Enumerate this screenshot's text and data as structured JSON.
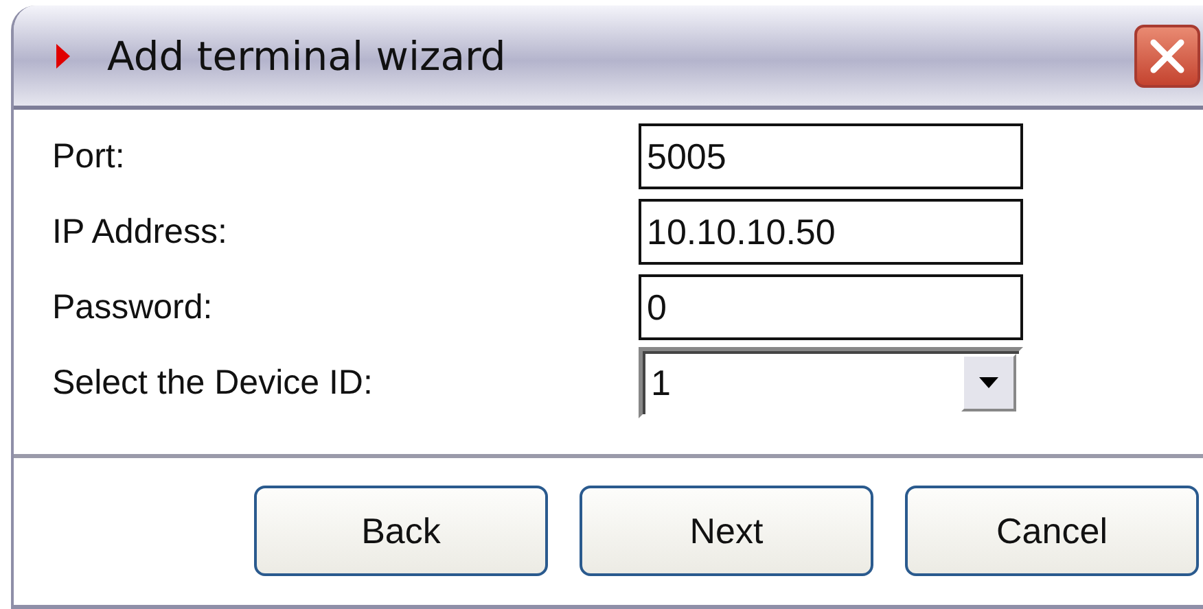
{
  "window": {
    "title": "Add terminal wizard"
  },
  "fields": [
    {
      "label": "Port:",
      "kind": "text",
      "value": "5005"
    },
    {
      "label": "IP Address:",
      "kind": "text",
      "value": "10.10.10.50"
    },
    {
      "label": "Password:",
      "kind": "text",
      "value": "0"
    },
    {
      "label": "Select the Device ID:",
      "kind": "dropdown",
      "value": "1"
    }
  ],
  "buttons": [
    "Back",
    "Next",
    "Cancel"
  ]
}
